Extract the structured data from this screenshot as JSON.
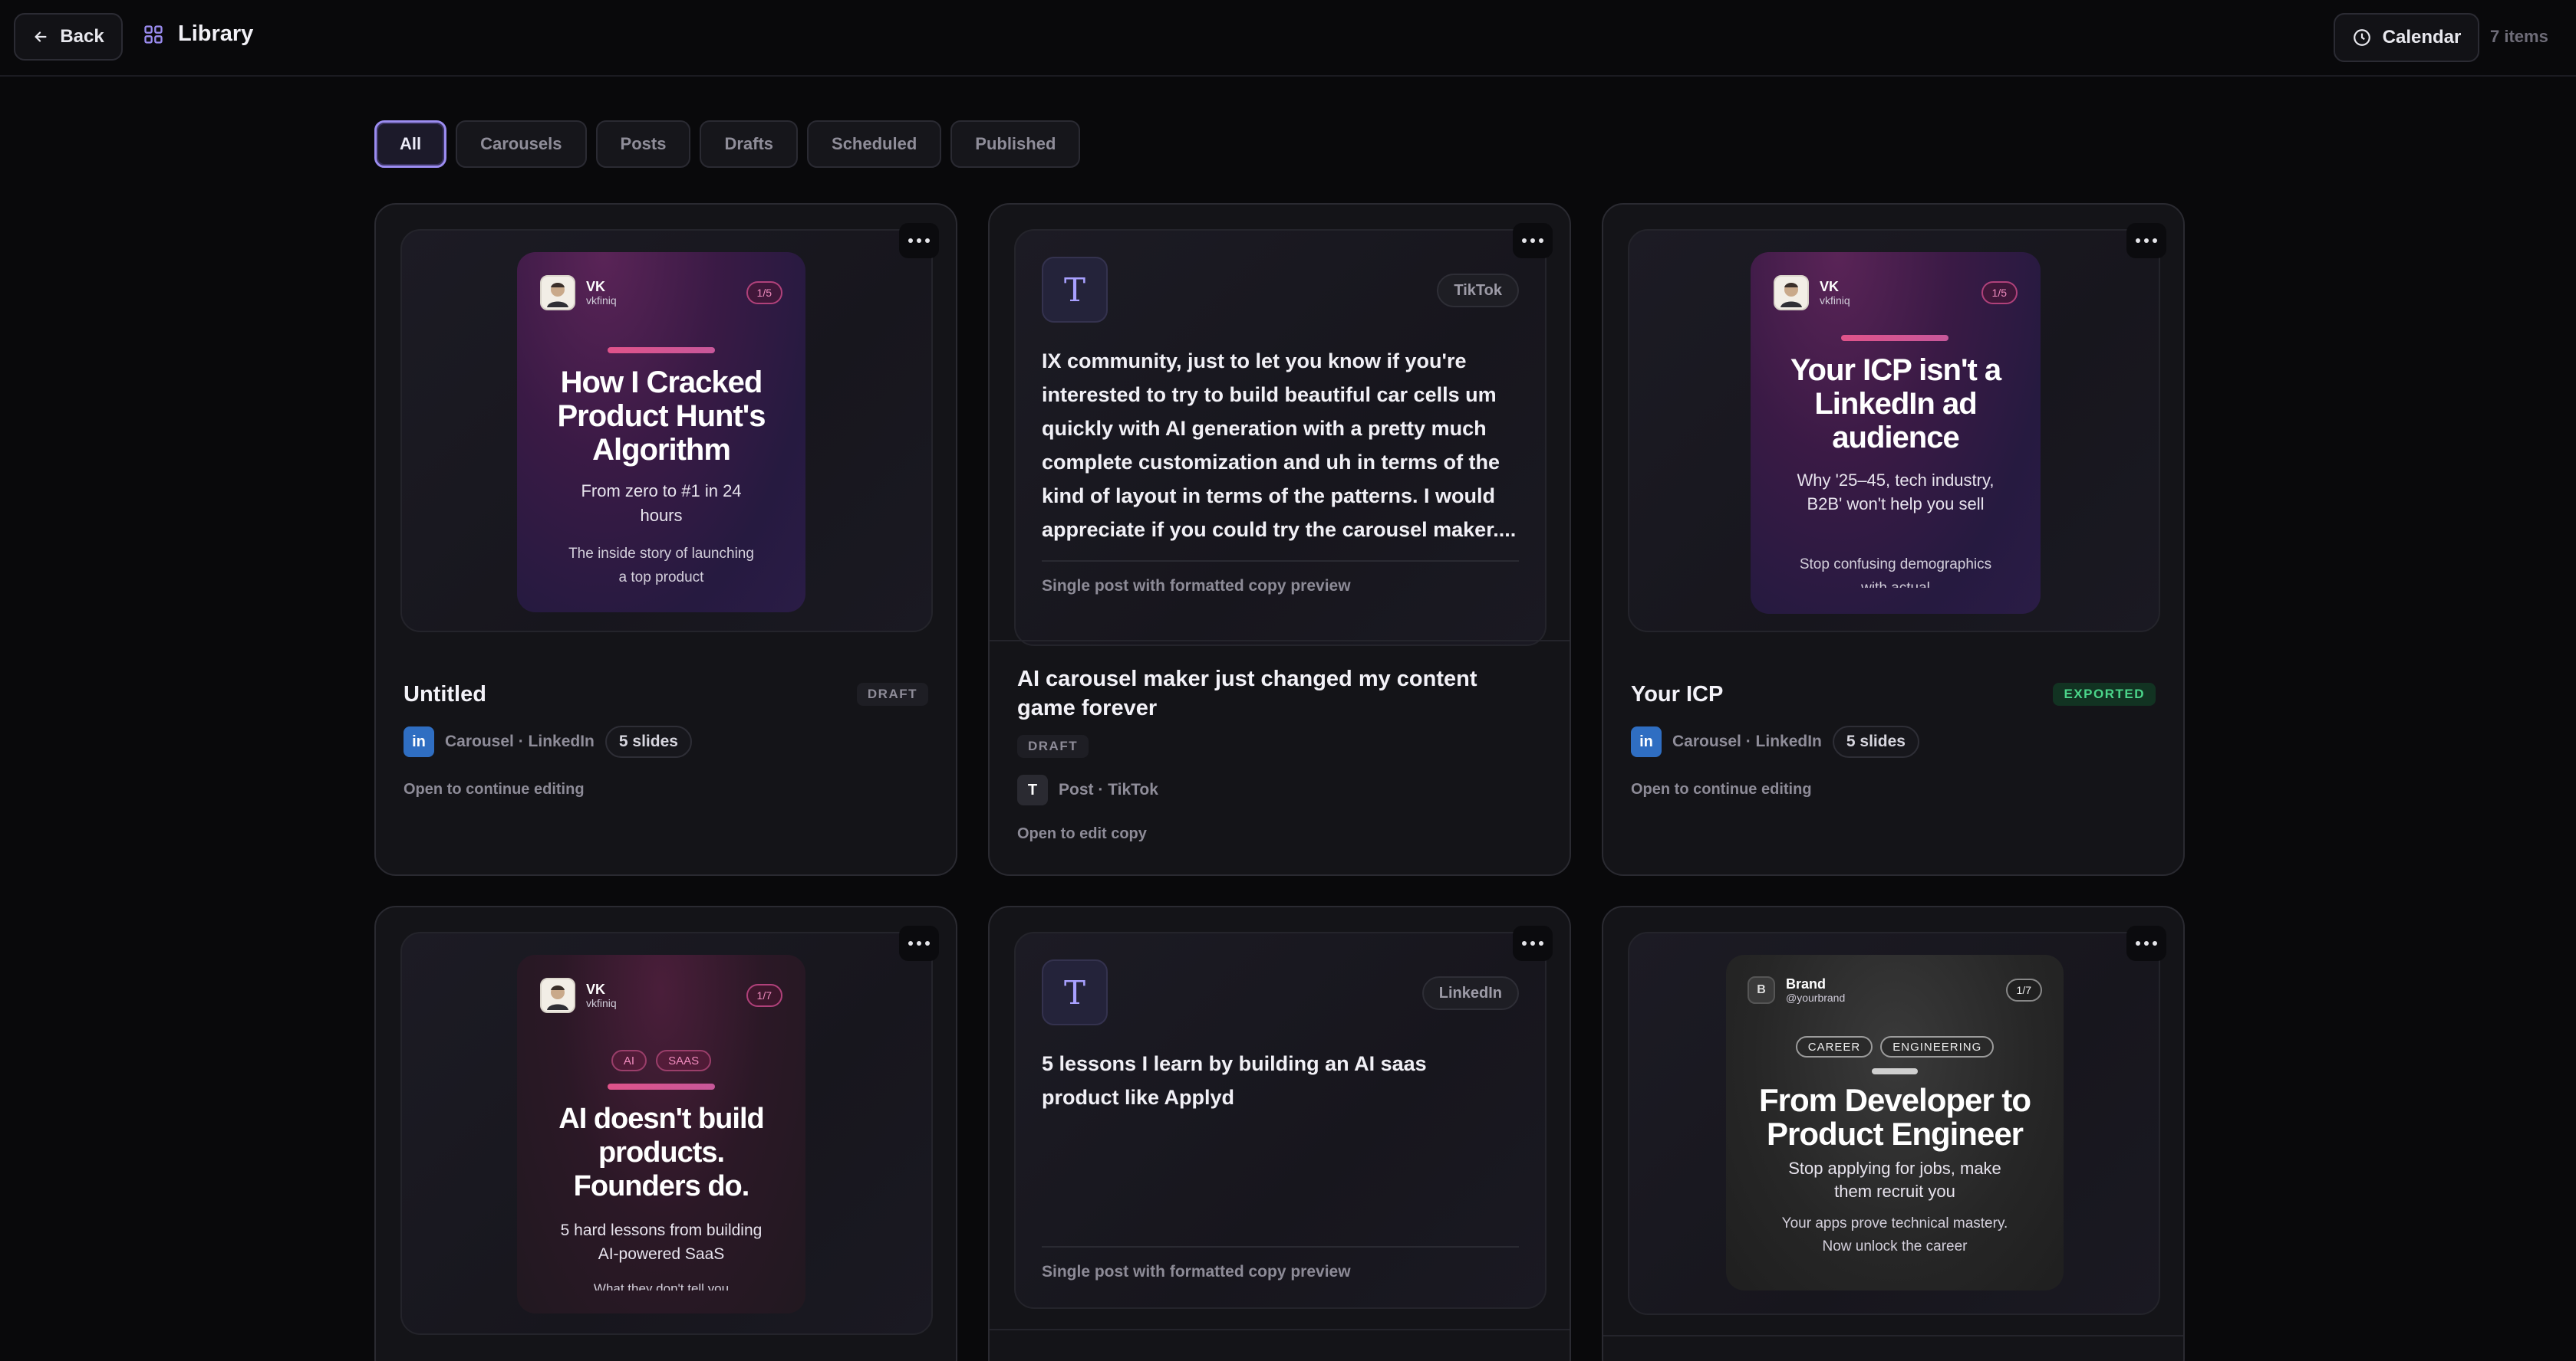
{
  "header": {
    "back_label": "Back",
    "library_label": "Library",
    "calendar_label": "Calendar",
    "item_count": "7 items"
  },
  "filters": [
    "All",
    "Carousels",
    "Posts",
    "Drafts",
    "Scheduled",
    "Published"
  ],
  "active_filter": "All",
  "cards": [
    {
      "kind": "carousel",
      "slide": {
        "author": "VK",
        "handle": "vkfiniq",
        "counter": "1/5",
        "title": "How I Cracked Product Hunt's Algorithm",
        "subtitle": "From zero to #1 in 24 hours",
        "body": "The inside story of launching a top product"
      },
      "title": "Untitled",
      "badge": "DRAFT",
      "meta": "Carousel · LinkedIn",
      "platform_icon": "in",
      "slides": "5 slides",
      "hint": "Open to continue editing"
    },
    {
      "kind": "post",
      "logo": "T",
      "platform": "TikTok",
      "text": "IX community, just to let you know if you're interested to try to build beautiful car cells um quickly with AI generation with a pretty much complete customization and uh in terms of the kind of layout in terms of the patterns. I would appreciate if you could try the carousel maker....",
      "foot": "Single post with formatted copy preview",
      "title": "AI carousel maker just changed my content game forever",
      "badge": "DRAFT",
      "meta": "Post · TikTok",
      "platform_icon": "T",
      "hint": "Open to edit copy"
    },
    {
      "kind": "carousel",
      "slide": {
        "author": "VK",
        "handle": "vkfiniq",
        "counter": "1/5",
        "title": "Your ICP isn't a LinkedIn ad audience",
        "subtitle": "Why '25–45, tech industry, B2B' won't help you sell",
        "body": "Stop confusing demographics with actual"
      },
      "title": "Your ICP",
      "badge": "EXPORTED",
      "meta": "Carousel · LinkedIn",
      "platform_icon": "in",
      "slides": "5 slides",
      "hint": "Open to continue editing"
    },
    {
      "kind": "carousel",
      "slide": {
        "author": "VK",
        "handle": "vkfiniq",
        "counter": "1/7",
        "tags": [
          "AI",
          "SAAS"
        ],
        "title": "AI doesn't build products. Founders do.",
        "subtitle": "5 hard lessons from building AI-powered SaaS",
        "body": "What they don't tell you"
      }
    },
    {
      "kind": "post",
      "logo": "T",
      "platform": "LinkedIn",
      "text": "5 lessons I learn by building an AI saas product like Applyd",
      "foot": "Single post with formatted copy preview"
    },
    {
      "kind": "carousel",
      "slide": {
        "author": "Brand",
        "handle": "@yourbrand",
        "counter": "1/7",
        "avatar_letter": "B",
        "tags": [
          "CAREER",
          "ENGINEERING"
        ],
        "title": "From Developer to Product Engineer",
        "subtitle": "Stop applying for jobs, make them recruit you",
        "body": "Your apps prove technical mastery. Now unlock the career"
      }
    }
  ]
}
